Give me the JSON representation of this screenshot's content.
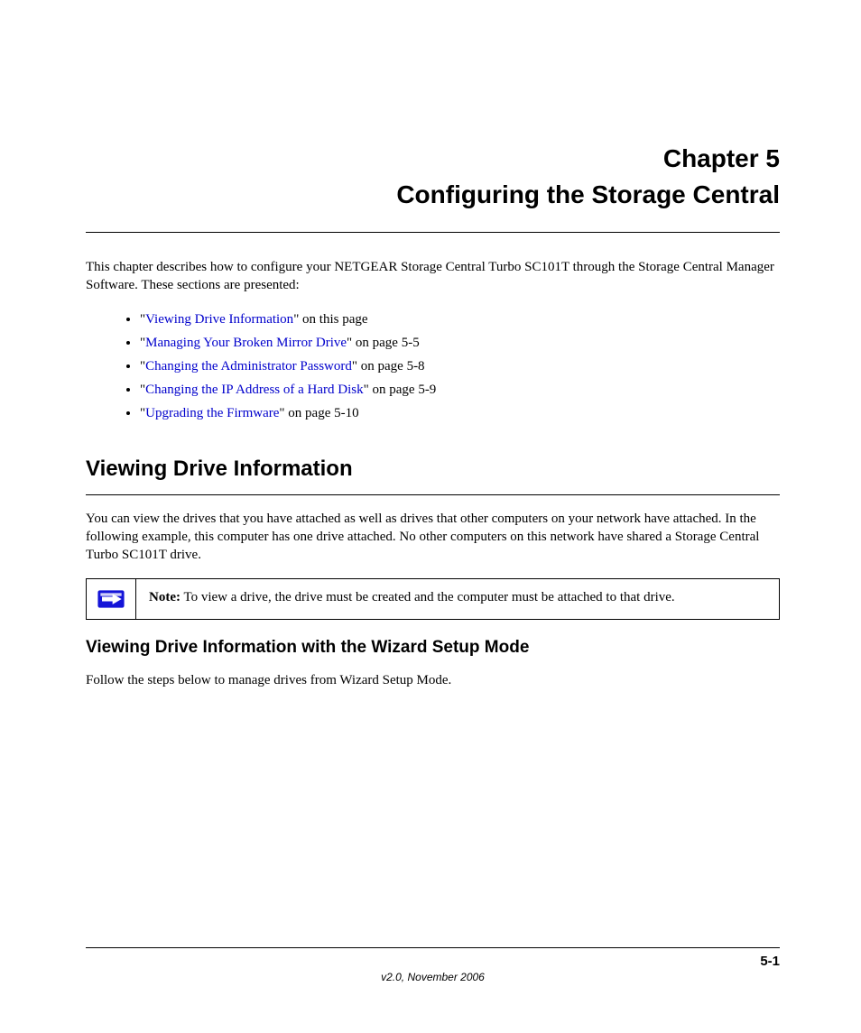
{
  "chapter": {
    "label": "Chapter 5",
    "title": "Configuring the Storage Central"
  },
  "intro": "This chapter describes how to configure your NETGEAR Storage Central Turbo SC101T through the Storage Central Manager Software. These sections are presented:",
  "toc": [
    {
      "prefix": "\"",
      "link": "Viewing Drive Information",
      "suffix": "\" on this page"
    },
    {
      "prefix": "\"",
      "link": "Managing Your Broken Mirror Drive",
      "suffix": "\" on page 5-5"
    },
    {
      "prefix": "\"",
      "link": "Changing the Administrator Password",
      "suffix": "\" on page 5-8"
    },
    {
      "prefix": "\"",
      "link": "Changing the IP Address of a Hard Disk",
      "suffix": "\" on page 5-9"
    },
    {
      "prefix": "\"",
      "link": "Upgrading the Firmware",
      "suffix": "\" on page 5-10"
    }
  ],
  "section": {
    "title": "Viewing Drive Information",
    "body": "You can view the drives that you have attached as well as drives that other computers on your network have attached. In the following example, this computer has one drive attached. No other computers on this network have shared a Storage Central Turbo SC101T drive."
  },
  "note": {
    "label": "Note:",
    "text": " To view a drive, the drive must be created and the computer must be attached to that drive."
  },
  "subsection": {
    "title": "Viewing Drive Information with the Wizard Setup Mode",
    "body": "Follow the steps below to manage drives from Wizard Setup Mode."
  },
  "footer": {
    "left": "",
    "page": "5-1",
    "version": "v2.0, November 2006"
  }
}
